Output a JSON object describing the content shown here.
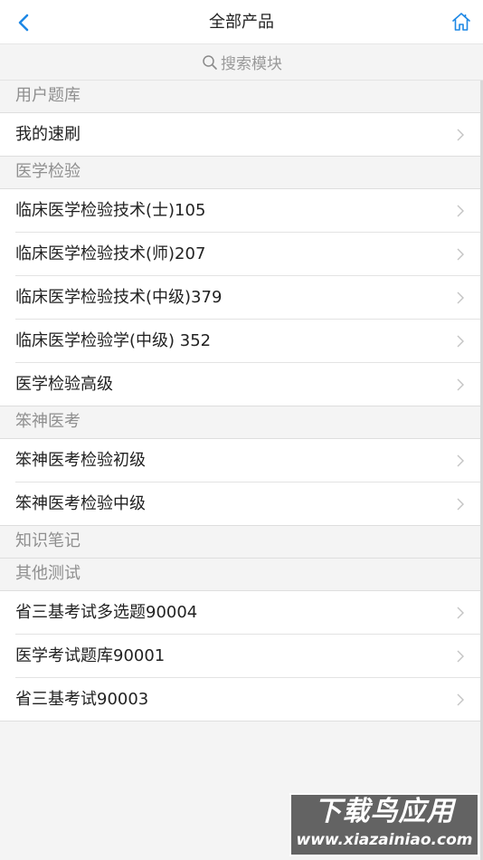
{
  "header": {
    "title": "全部产品",
    "back_icon": "chevron-left-icon",
    "home_icon": "home-icon",
    "accent_color": "#1e88e5"
  },
  "search": {
    "placeholder": "搜索模块",
    "icon": "search-icon"
  },
  "sections": [
    {
      "title": "用户题库",
      "items": [
        "我的速刷"
      ]
    },
    {
      "title": "医学检验",
      "items": [
        "临床医学检验技术(士)105",
        "临床医学检验技术(师)207",
        "临床医学检验技术(中级)379",
        "临床医学检验学(中级) 352",
        "医学检验高级"
      ]
    },
    {
      "title": "笨神医考",
      "items": [
        "笨神医考检验初级",
        "笨神医考检验中级"
      ]
    },
    {
      "title": "知识笔记",
      "items": []
    },
    {
      "title": "其他测试",
      "items": [
        "省三基考试多选题90004",
        "医学考试题库90001",
        "省三基考试90003"
      ]
    }
  ],
  "watermark": {
    "brand": "下载鸟应用",
    "url": "www.xiazainiao.com"
  }
}
